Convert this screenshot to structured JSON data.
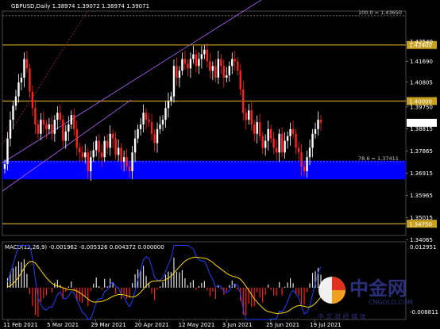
{
  "title": "GBPUSD,Daily  1.38974 1.39072 1.38974 1.39071",
  "colors": {
    "background": "#000000",
    "bull": "#ffffff",
    "bear": "#ff2020",
    "level_line": "#c8a020",
    "zone": "#0000ff",
    "channel": "#b060ff",
    "macd_line": "#2040ff",
    "signal_line": "#ffd700",
    "grid": "#404040"
  },
  "watermark": {
    "brand_cn": "中金网",
    "brand_en": "CNGOLD.COM",
    "slogan": "中 文 财 经 媒 体"
  },
  "chart_data": [
    {
      "type": "candlestick",
      "symbol": "GBPUSD",
      "timeframe": "Daily",
      "ohlc_header": {
        "open": 1.38974,
        "high": 1.39072,
        "low": 1.38974,
        "close": 1.39071
      },
      "y_range": [
        1.3425,
        1.4385
      ],
      "y_ticks": [
        "1.42540",
        "1.41690",
        "1.40805",
        "1.39750",
        "1.38815",
        "1.37865",
        "1.36915",
        "1.35965",
        "1.35015",
        "1.34065"
      ],
      "x_ticks": [
        "11 Feb 2021",
        "5 Mar 2021",
        "29 Mar 2021",
        "20 Apr 2021",
        "12 May 2021",
        "3 Jun 2021",
        "25 Jun 2021",
        "19 Jul 2021"
      ],
      "levels": [
        {
          "value": 1.424,
          "label": "1.42400",
          "kind": "solid"
        },
        {
          "value": 1.4,
          "label": "1.40000",
          "kind": "solid"
        },
        {
          "value": 1.3475,
          "label": "1.34750",
          "kind": "solid"
        },
        {
          "value": 1.3741,
          "label": "78.6 = 1.37411",
          "kind": "dotted"
        },
        {
          "value": 1.4365,
          "label": "100.0 = 1.43650",
          "kind": "dotted"
        }
      ],
      "current_price": {
        "value": 1.39071,
        "label": "1.39071"
      },
      "zone": {
        "from": 1.3665,
        "to": 1.3745
      },
      "series_close": [
        1.373,
        1.384,
        1.392,
        1.398,
        1.402,
        1.408,
        1.41,
        1.418,
        1.414,
        1.404,
        1.397,
        1.39,
        1.386,
        1.392,
        1.39,
        1.388,
        1.39,
        1.386,
        1.392,
        1.395,
        1.392,
        1.383,
        1.387,
        1.39,
        1.394,
        1.388,
        1.38,
        1.378,
        1.376,
        1.378,
        1.37,
        1.376,
        1.379,
        1.383,
        1.378,
        1.376,
        1.383,
        1.38,
        1.386,
        1.384,
        1.377,
        1.38,
        1.374,
        1.376,
        1.372,
        1.37,
        1.378,
        1.384,
        1.388,
        1.39,
        1.395,
        1.392,
        1.391,
        1.386,
        1.382,
        1.388,
        1.39,
        1.392,
        1.397,
        1.4,
        1.402,
        1.415,
        1.41,
        1.413,
        1.418,
        1.416,
        1.414,
        1.418,
        1.42,
        1.415,
        1.418,
        1.42,
        1.422,
        1.417,
        1.413,
        1.415,
        1.41,
        1.418,
        1.415,
        1.41,
        1.411,
        1.415,
        1.418,
        1.417,
        1.413,
        1.405,
        1.395,
        1.392,
        1.396,
        1.39,
        1.386,
        1.391,
        1.385,
        1.38,
        1.383,
        1.388,
        1.384,
        1.38,
        1.378,
        1.386,
        1.378,
        1.383,
        1.385,
        1.388,
        1.386,
        1.38,
        1.378,
        1.372,
        1.37,
        1.376,
        1.38,
        1.386,
        1.388,
        1.392,
        1.39071
      ]
    },
    {
      "type": "bar",
      "name": "MACD(12,26,9)",
      "header": "MACD(12,26,9) -0.001962 -0.005326 0.004372 0.000000",
      "y_ticks": [
        "0.012951",
        "-0.008811"
      ],
      "histogram_range": [
        -0.009,
        0.013
      ]
    }
  ]
}
